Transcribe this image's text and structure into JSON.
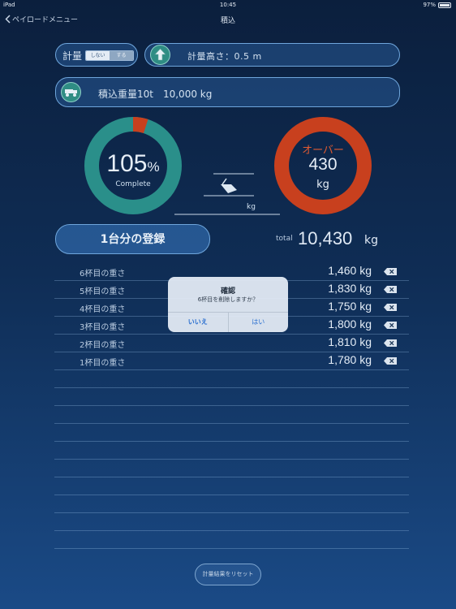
{
  "status_bar": {
    "device": "iPad",
    "time": "10:45",
    "battery": "97%"
  },
  "nav": {
    "back_label": "ペイロードメニュー",
    "title": "積込"
  },
  "measure": {
    "label": "計量",
    "toggle_off": "しない",
    "toggle_on": "する"
  },
  "height": {
    "text": "計量高さ：0.5 m"
  },
  "load": {
    "text": "積込重量10t　10,000 kg"
  },
  "progress": {
    "percent_value": "105",
    "percent_sign": "%",
    "complete_label": "Complete",
    "fraction": 1.05
  },
  "over": {
    "label": "オーバー",
    "value": "430",
    "unit": "kg"
  },
  "center": {
    "unit": "kg"
  },
  "register_button": "1台分の登録",
  "total": {
    "label": "total",
    "value": "10,430",
    "unit": "kg"
  },
  "rows": [
    {
      "label": "6杯目の重さ",
      "value": "1,460 kg"
    },
    {
      "label": "5杯目の重さ",
      "value": "1,830 kg"
    },
    {
      "label": "4杯目の重さ",
      "value": "1,750 kg"
    },
    {
      "label": "3杯目の重さ",
      "value": "1,800 kg"
    },
    {
      "label": "2杯目の重さ",
      "value": "1,810 kg"
    },
    {
      "label": "1杯目の重さ",
      "value": "1,780 kg"
    }
  ],
  "dialog": {
    "title": "確認",
    "message": "6杯目を削除しますか？",
    "no": "いいえ",
    "yes": "はい"
  },
  "reset_button": "計量結果をリセット",
  "colors": {
    "accent_teal": "#2a8f8a",
    "over_red": "#c8401e",
    "link_blue": "#2a6fd0"
  }
}
